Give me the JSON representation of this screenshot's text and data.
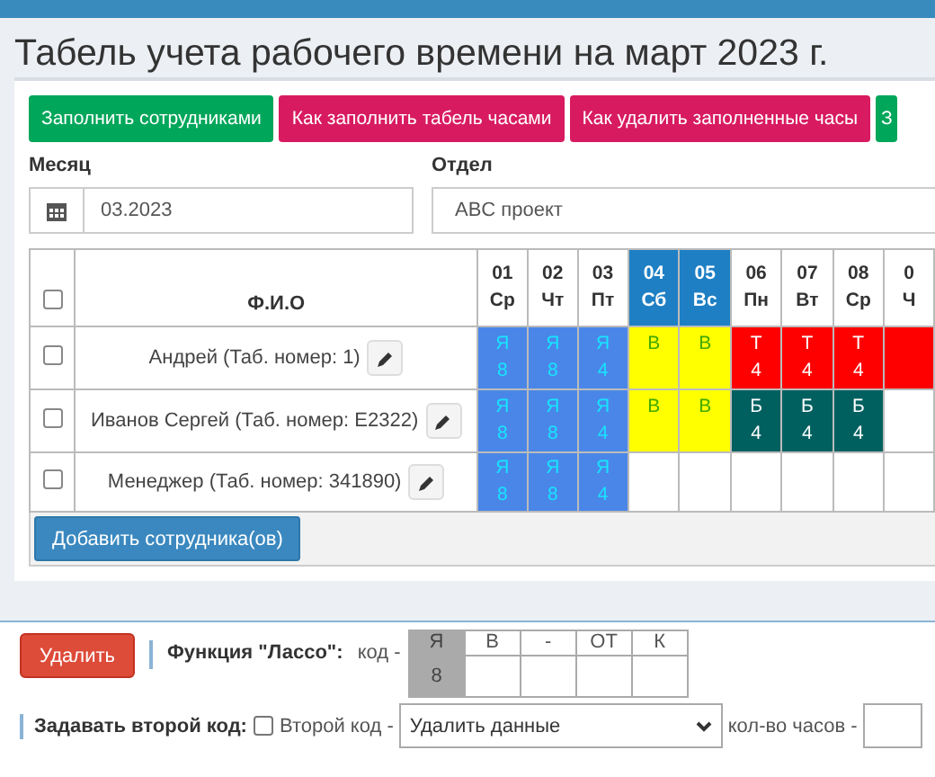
{
  "title": "Табель учета рабочего времени на март 2023 г.",
  "actions": [
    {
      "label": "Заполнить сотрудниками",
      "kind": "success"
    },
    {
      "label": "Как заполнить табель часами",
      "kind": "danger"
    },
    {
      "label": "Как удалить заполненные часы",
      "kind": "danger"
    },
    {
      "label": "З",
      "kind": "success"
    }
  ],
  "month": {
    "label": "Месяц",
    "value": "03.2023"
  },
  "department": {
    "label": "Отдел",
    "value": "ABC проект"
  },
  "table": {
    "name_column": "Ф.И.О",
    "select_all_checked": false,
    "days": [
      {
        "day": "01",
        "weekday": "Ср",
        "weekend": false
      },
      {
        "day": "02",
        "weekday": "Чт",
        "weekend": false
      },
      {
        "day": "03",
        "weekday": "Пт",
        "weekend": false
      },
      {
        "day": "04",
        "weekday": "Сб",
        "weekend": true
      },
      {
        "day": "05",
        "weekday": "Вс",
        "weekend": true
      },
      {
        "day": "06",
        "weekday": "Пн",
        "weekend": false
      },
      {
        "day": "07",
        "weekday": "Вт",
        "weekend": false
      },
      {
        "day": "08",
        "weekday": "Ср",
        "weekend": false
      },
      {
        "day": "0",
        "weekday": "Ч",
        "weekend": false
      }
    ],
    "rows": [
      {
        "name": "Андрей (Таб. номер: 1)",
        "checked": false,
        "cells": [
          {
            "kind": "work",
            "code": "Я",
            "hours": "8"
          },
          {
            "kind": "work",
            "code": "Я",
            "hours": "8"
          },
          {
            "kind": "work",
            "code": "Я",
            "hours": "4"
          },
          {
            "kind": "weekend",
            "code": "В"
          },
          {
            "kind": "weekend",
            "code": "В"
          },
          {
            "kind": "trip",
            "code": "Т",
            "hours": "4"
          },
          {
            "kind": "trip",
            "code": "Т",
            "hours": "4"
          },
          {
            "kind": "trip",
            "code": "Т",
            "hours": "4"
          },
          {
            "kind": "trip"
          }
        ]
      },
      {
        "name": "Иванов Сергей (Таб. номер: E2322)",
        "checked": false,
        "cells": [
          {
            "kind": "work",
            "code": "Я",
            "hours": "8"
          },
          {
            "kind": "work",
            "code": "Я",
            "hours": "8"
          },
          {
            "kind": "work",
            "code": "Я",
            "hours": "4"
          },
          {
            "kind": "weekend",
            "code": "В"
          },
          {
            "kind": "weekend",
            "code": "В"
          },
          {
            "kind": "sick",
            "code": "Б",
            "hours": "4"
          },
          {
            "kind": "sick",
            "code": "Б",
            "hours": "4"
          },
          {
            "kind": "sick",
            "code": "Б",
            "hours": "4"
          },
          {
            "kind": "empty"
          }
        ]
      },
      {
        "name": "Менеджер (Таб. номер: 341890)",
        "checked": false,
        "cells": [
          {
            "kind": "work",
            "code": "Я",
            "hours": "8"
          },
          {
            "kind": "work",
            "code": "Я",
            "hours": "8"
          },
          {
            "kind": "work",
            "code": "Я",
            "hours": "4"
          },
          {
            "kind": "empty"
          },
          {
            "kind": "empty"
          },
          {
            "kind": "empty"
          },
          {
            "kind": "empty"
          },
          {
            "kind": "empty"
          },
          {
            "kind": "empty"
          }
        ]
      }
    ]
  },
  "add_button": "Добавить сотрудника(ов)",
  "delete_button": "Удалить",
  "lasso": {
    "label": "Функция \"Лассо\":",
    "code_label": "код -",
    "codes": [
      {
        "code": "Я",
        "hours": "8",
        "selected": true
      },
      {
        "code": "В",
        "selected": false
      },
      {
        "code": "-",
        "selected": false
      },
      {
        "code": "ОТ",
        "selected": false
      },
      {
        "code": "К",
        "selected": false
      }
    ]
  },
  "second_code": {
    "label": "Задавать второй код:",
    "checkbox_label": "Второй код -",
    "checked": false,
    "select_value": "Удалить данные",
    "hours_label": "кол-во часов -"
  }
}
